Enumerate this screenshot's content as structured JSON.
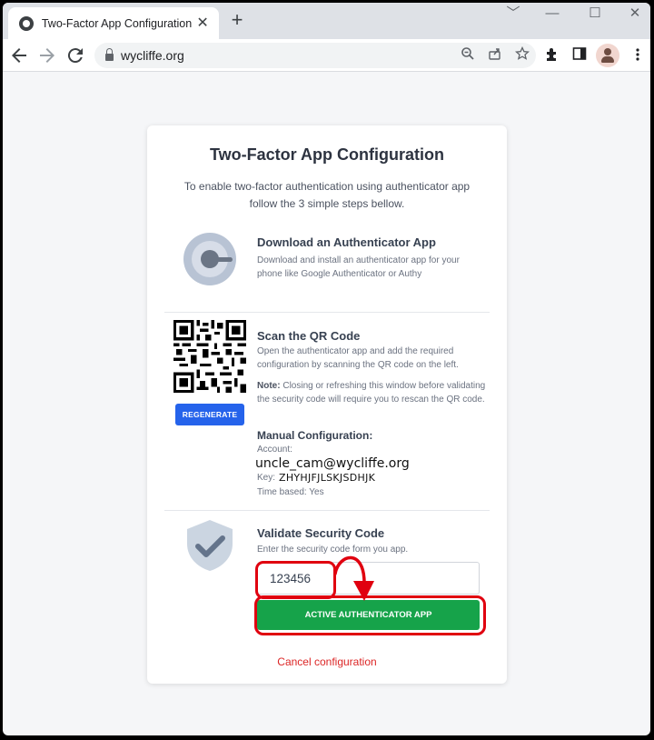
{
  "browser": {
    "tab_title": "Two-Factor App Configuration",
    "tab_close": "✕",
    "new_tab": "+",
    "url": "wycliffe.org",
    "window_minimize": "﹀",
    "window_restore": "—",
    "window_max": "☐",
    "window_close": "✕",
    "icons": {
      "back": "back-arrow-icon",
      "forward": "forward-arrow-icon",
      "reload": "reload-icon",
      "zoom": "zoom-icon",
      "share": "share-icon",
      "bookmark": "star-icon",
      "extensions": "puzzle-icon",
      "sidepanel": "side-panel-icon",
      "profile": "profile-avatar-icon",
      "menu": "kebab-menu-icon"
    }
  },
  "page": {
    "title": "Two-Factor App Configuration",
    "intro": "To enable two-factor authentication using authenticator app follow the 3 simple steps bellow.",
    "step1": {
      "title": "Download an Authenticator App",
      "text": "Download and install an authenticator app for your phone like Google Authenticator or Authy"
    },
    "step2": {
      "title": "Scan the QR Code",
      "text": "Open the authenticator app and add the required configuration by scanning the QR code on the left.",
      "note_label": "Note:",
      "note_text": " Closing or refreshing this window before validating the security code will require you to rescan the QR code.",
      "regenerate_label": "REGENERATE",
      "manual_title": "Manual Configuration:",
      "account_label": "Account:",
      "account_value": "uncle_cam@wycliffe.org",
      "key_label": "Key:",
      "key_value": "ZHYHJFJLSKJSDHJK",
      "time_based": "Time based: Yes"
    },
    "step3": {
      "title": "Validate Security Code",
      "text": "Enter the security code form you app.",
      "code_value": "123456",
      "activate_label": "ACTIVE AUTHENTICATOR APP"
    },
    "cancel_label": "Cancel configuration"
  },
  "colors": {
    "primary_button": "#2563eb",
    "success_button": "#16a34a",
    "cancel_link": "#dc2626",
    "annotation": "#e0000f"
  }
}
